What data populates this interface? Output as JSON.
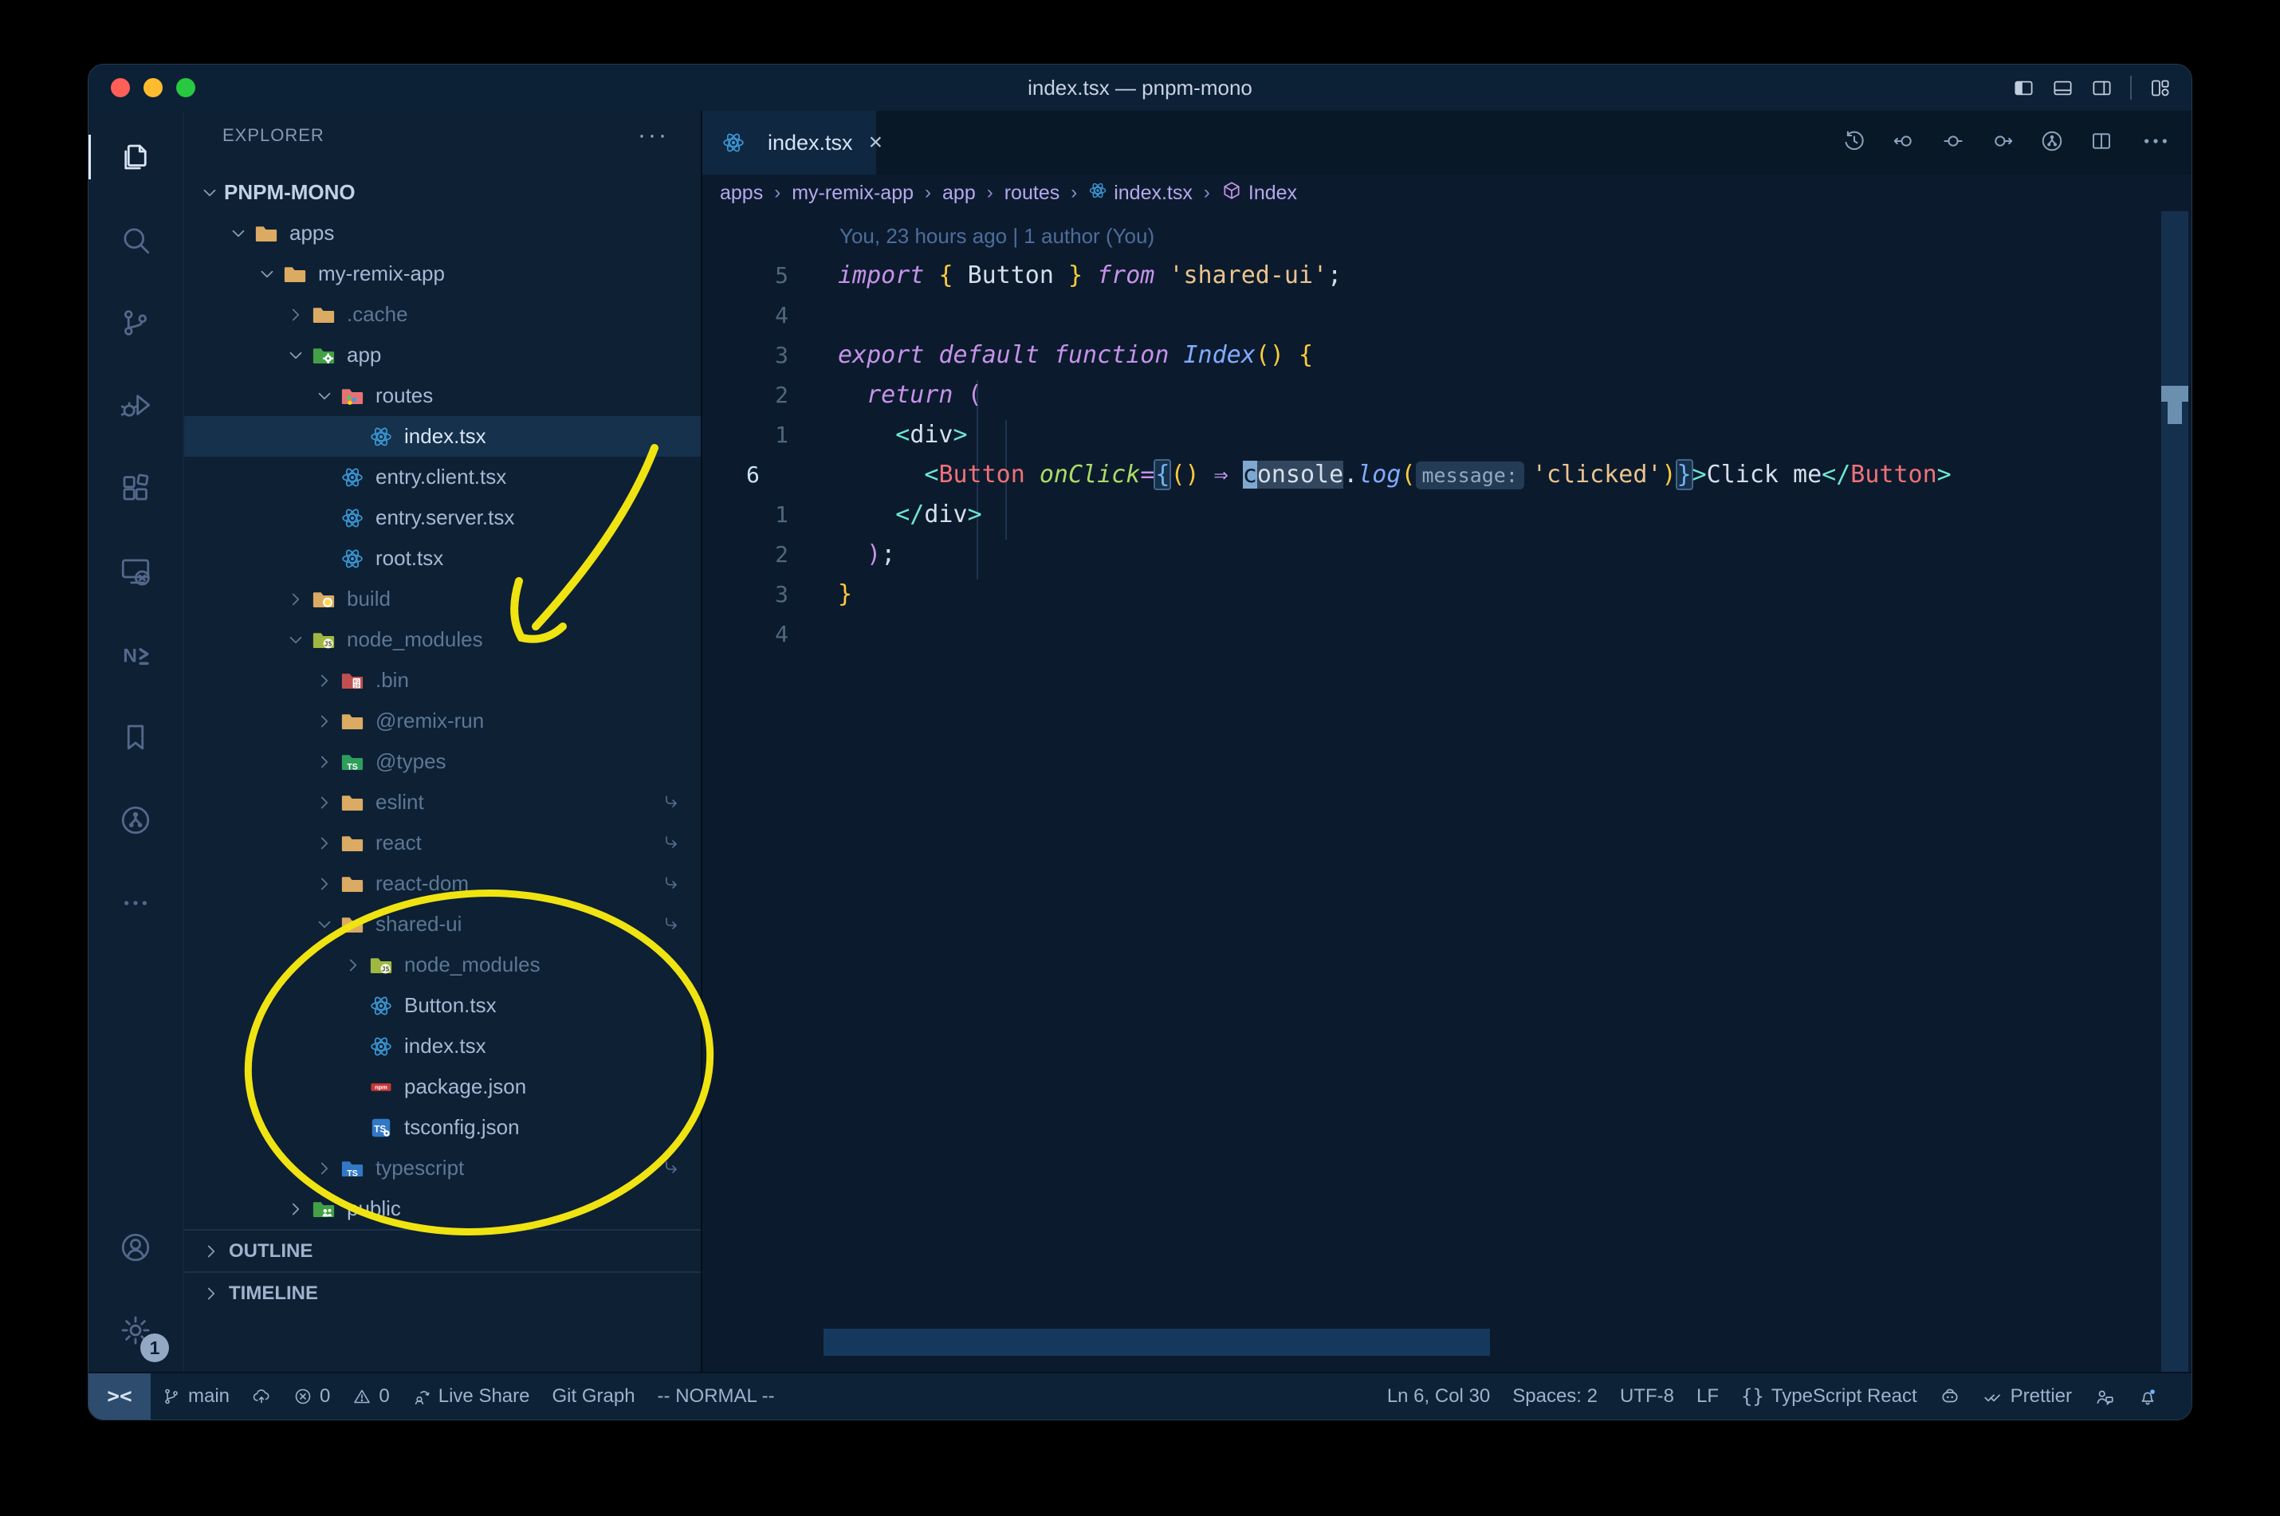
{
  "window": {
    "title": "index.tsx — pnpm-mono"
  },
  "titlebar": {
    "layout_icons": [
      "toggle-sidebar-left",
      "toggle-panel-bottom",
      "toggle-sidebar-right",
      "customize-layout"
    ]
  },
  "activity_bar": {
    "top": [
      {
        "name": "explorer",
        "active": true
      },
      {
        "name": "search"
      },
      {
        "name": "source-control"
      },
      {
        "name": "run-debug"
      },
      {
        "name": "extensions"
      },
      {
        "name": "remote-explorer"
      },
      {
        "name": "nx-console"
      },
      {
        "name": "bookmarks"
      },
      {
        "name": "git-graph"
      },
      {
        "name": "more"
      }
    ],
    "bottom": [
      {
        "name": "accounts"
      },
      {
        "name": "settings",
        "badge": "1"
      }
    ]
  },
  "sidebar": {
    "header": {
      "title": "EXPLORER",
      "more": "···"
    },
    "tree": [
      {
        "label": "PNPM-MONO",
        "depth": 0,
        "expand": "open",
        "root": true
      },
      {
        "label": "apps",
        "depth": 1,
        "expand": "open",
        "icon": "folder-tan"
      },
      {
        "label": "my-remix-app",
        "depth": 2,
        "expand": "open",
        "icon": "folder-tan"
      },
      {
        "label": ".cache",
        "depth": 3,
        "expand": "closed",
        "icon": "folder-tan",
        "dim": true
      },
      {
        "label": "app",
        "depth": 3,
        "expand": "open",
        "icon": "folder-app"
      },
      {
        "label": "routes",
        "depth": 4,
        "expand": "open",
        "icon": "folder-routes"
      },
      {
        "label": "index.tsx",
        "depth": 5,
        "icon": "react",
        "selected": true
      },
      {
        "label": "entry.client.tsx",
        "depth": 4,
        "icon": "react"
      },
      {
        "label": "entry.server.tsx",
        "depth": 4,
        "icon": "react"
      },
      {
        "label": "root.tsx",
        "depth": 4,
        "icon": "react"
      },
      {
        "label": "build",
        "depth": 3,
        "expand": "closed",
        "icon": "folder-build",
        "dim": true
      },
      {
        "label": "node_modules",
        "depth": 3,
        "expand": "open",
        "icon": "folder-js",
        "dim": true
      },
      {
        "label": ".bin",
        "depth": 4,
        "expand": "closed",
        "icon": "folder-bin",
        "dim": true
      },
      {
        "label": "@remix-run",
        "depth": 4,
        "expand": "closed",
        "icon": "folder-tan",
        "dim": true
      },
      {
        "label": "@types",
        "depth": 4,
        "expand": "closed",
        "icon": "folder-types",
        "dim": true
      },
      {
        "label": "eslint",
        "depth": 4,
        "expand": "closed",
        "icon": "folder-tan",
        "dim": true,
        "symlink": true
      },
      {
        "label": "react",
        "depth": 4,
        "expand": "closed",
        "icon": "folder-tan",
        "dim": true,
        "symlink": true
      },
      {
        "label": "react-dom",
        "depth": 4,
        "expand": "closed",
        "icon": "folder-tan",
        "dim": true,
        "symlink": true
      },
      {
        "label": "shared-ui",
        "depth": 4,
        "expand": "open",
        "icon": "folder-tan",
        "dim": true,
        "symlink": true
      },
      {
        "label": "node_modules",
        "depth": 5,
        "expand": "closed",
        "icon": "folder-js",
        "dim": true
      },
      {
        "label": "Button.tsx",
        "depth": 5,
        "icon": "react"
      },
      {
        "label": "index.tsx",
        "depth": 5,
        "icon": "react"
      },
      {
        "label": "package.json",
        "depth": 5,
        "icon": "npm"
      },
      {
        "label": "tsconfig.json",
        "depth": 5,
        "icon": "tsconfig"
      },
      {
        "label": "typescript",
        "depth": 4,
        "expand": "closed",
        "icon": "folder-ts",
        "dim": true,
        "symlink": true
      },
      {
        "label": "public",
        "depth": 3,
        "expand": "closed",
        "icon": "folder-public"
      }
    ],
    "sections": [
      {
        "label": "OUTLINE"
      },
      {
        "label": "TIMELINE"
      }
    ]
  },
  "editor": {
    "tab": {
      "label": "index.tsx",
      "icon": "react",
      "close": "×"
    },
    "actions": [
      "history",
      "prev-change",
      "change",
      "next-change",
      "commit-graph",
      "split-editor",
      "more"
    ],
    "breadcrumbs": [
      {
        "label": "apps"
      },
      {
        "label": "my-remix-app"
      },
      {
        "label": "app"
      },
      {
        "label": "routes"
      },
      {
        "label": "index.tsx",
        "icon": "react"
      },
      {
        "label": "Index",
        "icon": "symbol-cube"
      }
    ],
    "blame": "You, 23 hours ago | 1 author (You)",
    "code": {
      "lines": [
        {
          "n": "5",
          "tokens": [
            [
              "kw",
              "import"
            ],
            [
              "t",
              " "
            ],
            [
              "y",
              "{"
            ],
            [
              "t",
              " "
            ],
            [
              "txt",
              "Button"
            ],
            [
              "t",
              " "
            ],
            [
              "y",
              "}"
            ],
            [
              "t",
              " "
            ],
            [
              "kw",
              "from"
            ],
            [
              "t",
              " "
            ],
            [
              "str",
              "'shared-ui'"
            ],
            [
              "txt",
              ";"
            ]
          ]
        },
        {
          "n": "4",
          "tokens": []
        },
        {
          "n": "3",
          "tokens": [
            [
              "kw",
              "export"
            ],
            [
              "t",
              " "
            ],
            [
              "kw",
              "default"
            ],
            [
              "t",
              " "
            ],
            [
              "kw",
              "function"
            ],
            [
              "t",
              " "
            ],
            [
              "fn",
              "Index"
            ],
            [
              "y",
              "()"
            ],
            [
              "t",
              " "
            ],
            [
              "y",
              "{"
            ]
          ]
        },
        {
          "n": "2",
          "tokens": [
            [
              "t",
              "  "
            ],
            [
              "kw",
              "return"
            ],
            [
              "t",
              " "
            ],
            [
              "p",
              "("
            ]
          ]
        },
        {
          "n": "1",
          "tokens": [
            [
              "t",
              "    "
            ],
            [
              "tag",
              "<"
            ],
            [
              "txt",
              "div"
            ],
            [
              "tag",
              ">"
            ]
          ]
        },
        {
          "n": "6",
          "cur": true,
          "tokens": [
            [
              "t",
              "      "
            ],
            [
              "tag",
              "<"
            ],
            [
              "comp",
              "Button"
            ],
            [
              "t",
              " "
            ],
            [
              "attr",
              "onClick"
            ],
            [
              "op",
              "="
            ],
            [
              "brm",
              "{"
            ],
            [
              "y",
              "()"
            ],
            [
              "t",
              " "
            ],
            [
              "op",
              "⇒"
            ],
            [
              "t",
              " "
            ],
            [
              "cur",
              "c"
            ],
            [
              "hlw",
              "onsole"
            ],
            [
              "txt",
              "."
            ],
            [
              "fn",
              "log"
            ],
            [
              "y",
              "("
            ],
            [
              "inlay",
              "message:"
            ],
            [
              "str",
              "'clicked'"
            ],
            [
              "y",
              ")"
            ],
            [
              "brm",
              "}"
            ],
            [
              "tag",
              ">"
            ],
            [
              "txt",
              "Click me"
            ],
            [
              "tag",
              "</"
            ],
            [
              "comp",
              "Button"
            ],
            [
              "tag",
              ">"
            ]
          ]
        },
        {
          "n": "1",
          "tokens": [
            [
              "t",
              "    "
            ],
            [
              "tag",
              "</"
            ],
            [
              "txt",
              "div"
            ],
            [
              "tag",
              ">"
            ]
          ]
        },
        {
          "n": "2",
          "tokens": [
            [
              "t",
              "  "
            ],
            [
              "p",
              ")"
            ],
            [
              "txt",
              ";"
            ]
          ]
        },
        {
          "n": "3",
          "tokens": [
            [
              "y",
              "}"
            ]
          ]
        },
        {
          "n": "4",
          "tokens": []
        }
      ]
    }
  },
  "status_bar": {
    "left": [
      {
        "name": "remote",
        "label": "><"
      },
      {
        "name": "branch",
        "icon": "branch",
        "label": "main"
      },
      {
        "name": "sync",
        "icon": "cloud-upload"
      },
      {
        "name": "errors",
        "icon": "error",
        "label": "0"
      },
      {
        "name": "warnings",
        "icon": "warning",
        "label": "0"
      },
      {
        "name": "live-share",
        "icon": "live-share",
        "label": "Live Share"
      },
      {
        "name": "git-graph",
        "label": "Git Graph"
      },
      {
        "name": "vim-mode",
        "label": "-- NORMAL --"
      }
    ],
    "right": [
      {
        "name": "cursor-position",
        "label": "Ln 6, Col 30"
      },
      {
        "name": "indentation",
        "label": "Spaces: 2"
      },
      {
        "name": "encoding",
        "label": "UTF-8"
      },
      {
        "name": "eol",
        "label": "LF"
      },
      {
        "name": "language",
        "icon": "braces",
        "label": "TypeScript React"
      },
      {
        "name": "copilot",
        "icon": "copilot"
      },
      {
        "name": "prettier",
        "icon": "double-check",
        "label": "Prettier"
      },
      {
        "name": "feedback",
        "icon": "feedback"
      },
      {
        "name": "notifications",
        "icon": "bell-dot"
      }
    ]
  },
  "annotations": {
    "color": "#f0e312"
  }
}
